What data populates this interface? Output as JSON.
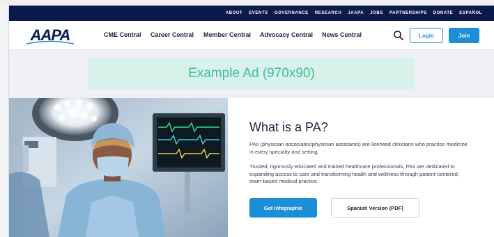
{
  "utility_nav": {
    "items": [
      "ABOUT",
      "EVENTS",
      "GOVERNANCE",
      "RESEARCH",
      "JAAPA",
      "JOBS",
      "PARTNERSHIPS",
      "DONATE",
      "ESPAÑOL"
    ]
  },
  "header": {
    "logo_text": "AAPA",
    "nav": [
      "CME Central",
      "Career Central",
      "Member Central",
      "Advocacy Central",
      "News Central"
    ],
    "login_label": "Login",
    "join_label": "Join"
  },
  "ad": {
    "text": "Example Ad (970x90)"
  },
  "hero": {
    "title": "What is a PA?",
    "paragraph_1": "PAs (physician associates/physician assistants) are licensed clinicians who practice medicine in every specialty and setting.",
    "paragraph_2": "Trusted, rigorously educated and trained healthcare professionals, PAs are dedicated to expanding access to care and transforming health and wellness through patient-centered, team-based medical practice.",
    "primary_button": "Get Infographic",
    "secondary_button": "Spanish Version (PDF)"
  },
  "colors": {
    "utility_bar": "#0c1a4b",
    "primary_blue": "#1c8ed8",
    "ad_background": "#d8f1ea",
    "ad_text": "#3bbf9a",
    "heading": "#1a2340"
  },
  "icons": [
    "search-icon"
  ]
}
